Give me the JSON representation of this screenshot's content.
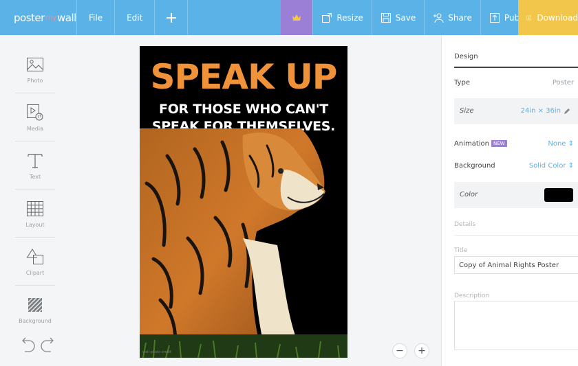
{
  "colors": {
    "topbar": "#5ab2e6",
    "crown_bg": "#9b7ed6",
    "download_bg": "#f1c64a",
    "headline": "#f0923a",
    "swatch": "#000000"
  },
  "header": {
    "logo": {
      "part1": "poster",
      "part2": "my",
      "part3": "wall"
    },
    "menu": {
      "file": "File",
      "edit": "Edit"
    },
    "tools": {
      "resize": "Resize",
      "save": "Save",
      "share": "Share",
      "publish": "Publish",
      "download": "Download"
    },
    "icons": [
      "plus-icon",
      "crown-icon",
      "resize-icon",
      "save-icon",
      "share-icon",
      "publish-icon",
      "download-icon"
    ]
  },
  "sidebar": {
    "items": [
      {
        "label": "Photo",
        "icon": "photo-icon"
      },
      {
        "label": "Media",
        "icon": "media-icon"
      },
      {
        "label": "Text",
        "icon": "text-icon"
      },
      {
        "label": "Layout",
        "icon": "layout-icon"
      },
      {
        "label": "Clipart",
        "icon": "clipart-icon"
      },
      {
        "label": "Background",
        "icon": "background-icon"
      }
    ],
    "undo_icon": "undo-icon",
    "redo_icon": "redo-icon"
  },
  "poster": {
    "headline": "SPEAK UP",
    "subline_1": "FOR THOSE WHO CAN'T",
    "subline_2": "SPEAK FOR THEMSELVES.",
    "image": "tiger-photo",
    "credit": "wall photo credit"
  },
  "zoom": {
    "out": "−",
    "in": "+"
  },
  "panel": {
    "tab": "Design",
    "type_label": "Type",
    "type_value": "Poster",
    "size_label": "Size",
    "size_value": "24in × 36in",
    "animation_label": "Animation",
    "animation_badge": "NEW",
    "animation_value": "None ⇕",
    "background_label": "Background",
    "background_value": "Solid Color ⇕",
    "color_label": "Color",
    "details_label": "Details",
    "title_label": "Title",
    "title_value": "Copy of Animal Rights Poster",
    "description_label": "Description",
    "description_value": ""
  }
}
